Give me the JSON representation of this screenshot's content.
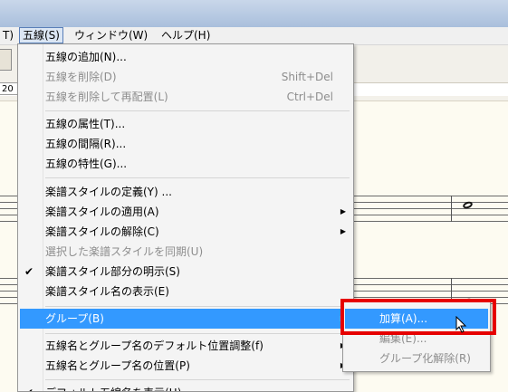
{
  "menubar": {
    "items": [
      "T)",
      "五線(S)",
      "ウィンドウ(W)",
      "ヘルプ(H)"
    ]
  },
  "toolbar": {
    "number_value": "20"
  },
  "menu": {
    "items": [
      {
        "label": "五線の追加(N)...",
        "shortcut": "",
        "disabled": false
      },
      {
        "label": "五線を削除(D)",
        "shortcut": "Shift+Del",
        "disabled": true
      },
      {
        "label": "五線を削除して再配置(L)",
        "shortcut": "Ctrl+Del",
        "disabled": true
      },
      {
        "label": "五線の属性(T)...",
        "shortcut": "",
        "disabled": false
      },
      {
        "label": "五線の間隔(R)...",
        "shortcut": "",
        "disabled": false
      },
      {
        "label": "五線の特性(G)...",
        "shortcut": "",
        "disabled": false
      },
      {
        "label": "楽譜スタイルの定義(Y) ...",
        "shortcut": "",
        "disabled": false
      },
      {
        "label": "楽譜スタイルの適用(A)",
        "submenu": true,
        "disabled": false
      },
      {
        "label": "楽譜スタイルの解除(C)",
        "submenu": true,
        "disabled": false
      },
      {
        "label": "選択した楽譜スタイルを同期(U)",
        "disabled": true
      },
      {
        "label": "楽譜スタイル部分の明示(S)",
        "checked": true,
        "disabled": false
      },
      {
        "label": "楽譜スタイル名の表示(E)",
        "disabled": false
      },
      {
        "label": "グループ(B)",
        "submenu": true,
        "highlighted": true
      },
      {
        "label": "五線名とグループ名のデフォルト位置調整(f)",
        "submenu": true
      },
      {
        "label": "五線名とグループ名の位置(P)",
        "submenu": true
      },
      {
        "label": "デフォルト五線名を表示(H)",
        "checked": true
      }
    ]
  },
  "submenu": {
    "items": [
      {
        "label": "加算(A)...",
        "highlighted": true
      },
      {
        "label": "編集(E)...",
        "disabled": true
      },
      {
        "label": "グループ化解除(R)",
        "disabled": true
      }
    ]
  },
  "icons": {
    "check": "checkmark-icon",
    "arrow": "submenu-arrow-icon",
    "cursor": "mouse-cursor-icon"
  },
  "colors": {
    "highlight": "#3399ff",
    "annotation_box": "#e60000"
  }
}
